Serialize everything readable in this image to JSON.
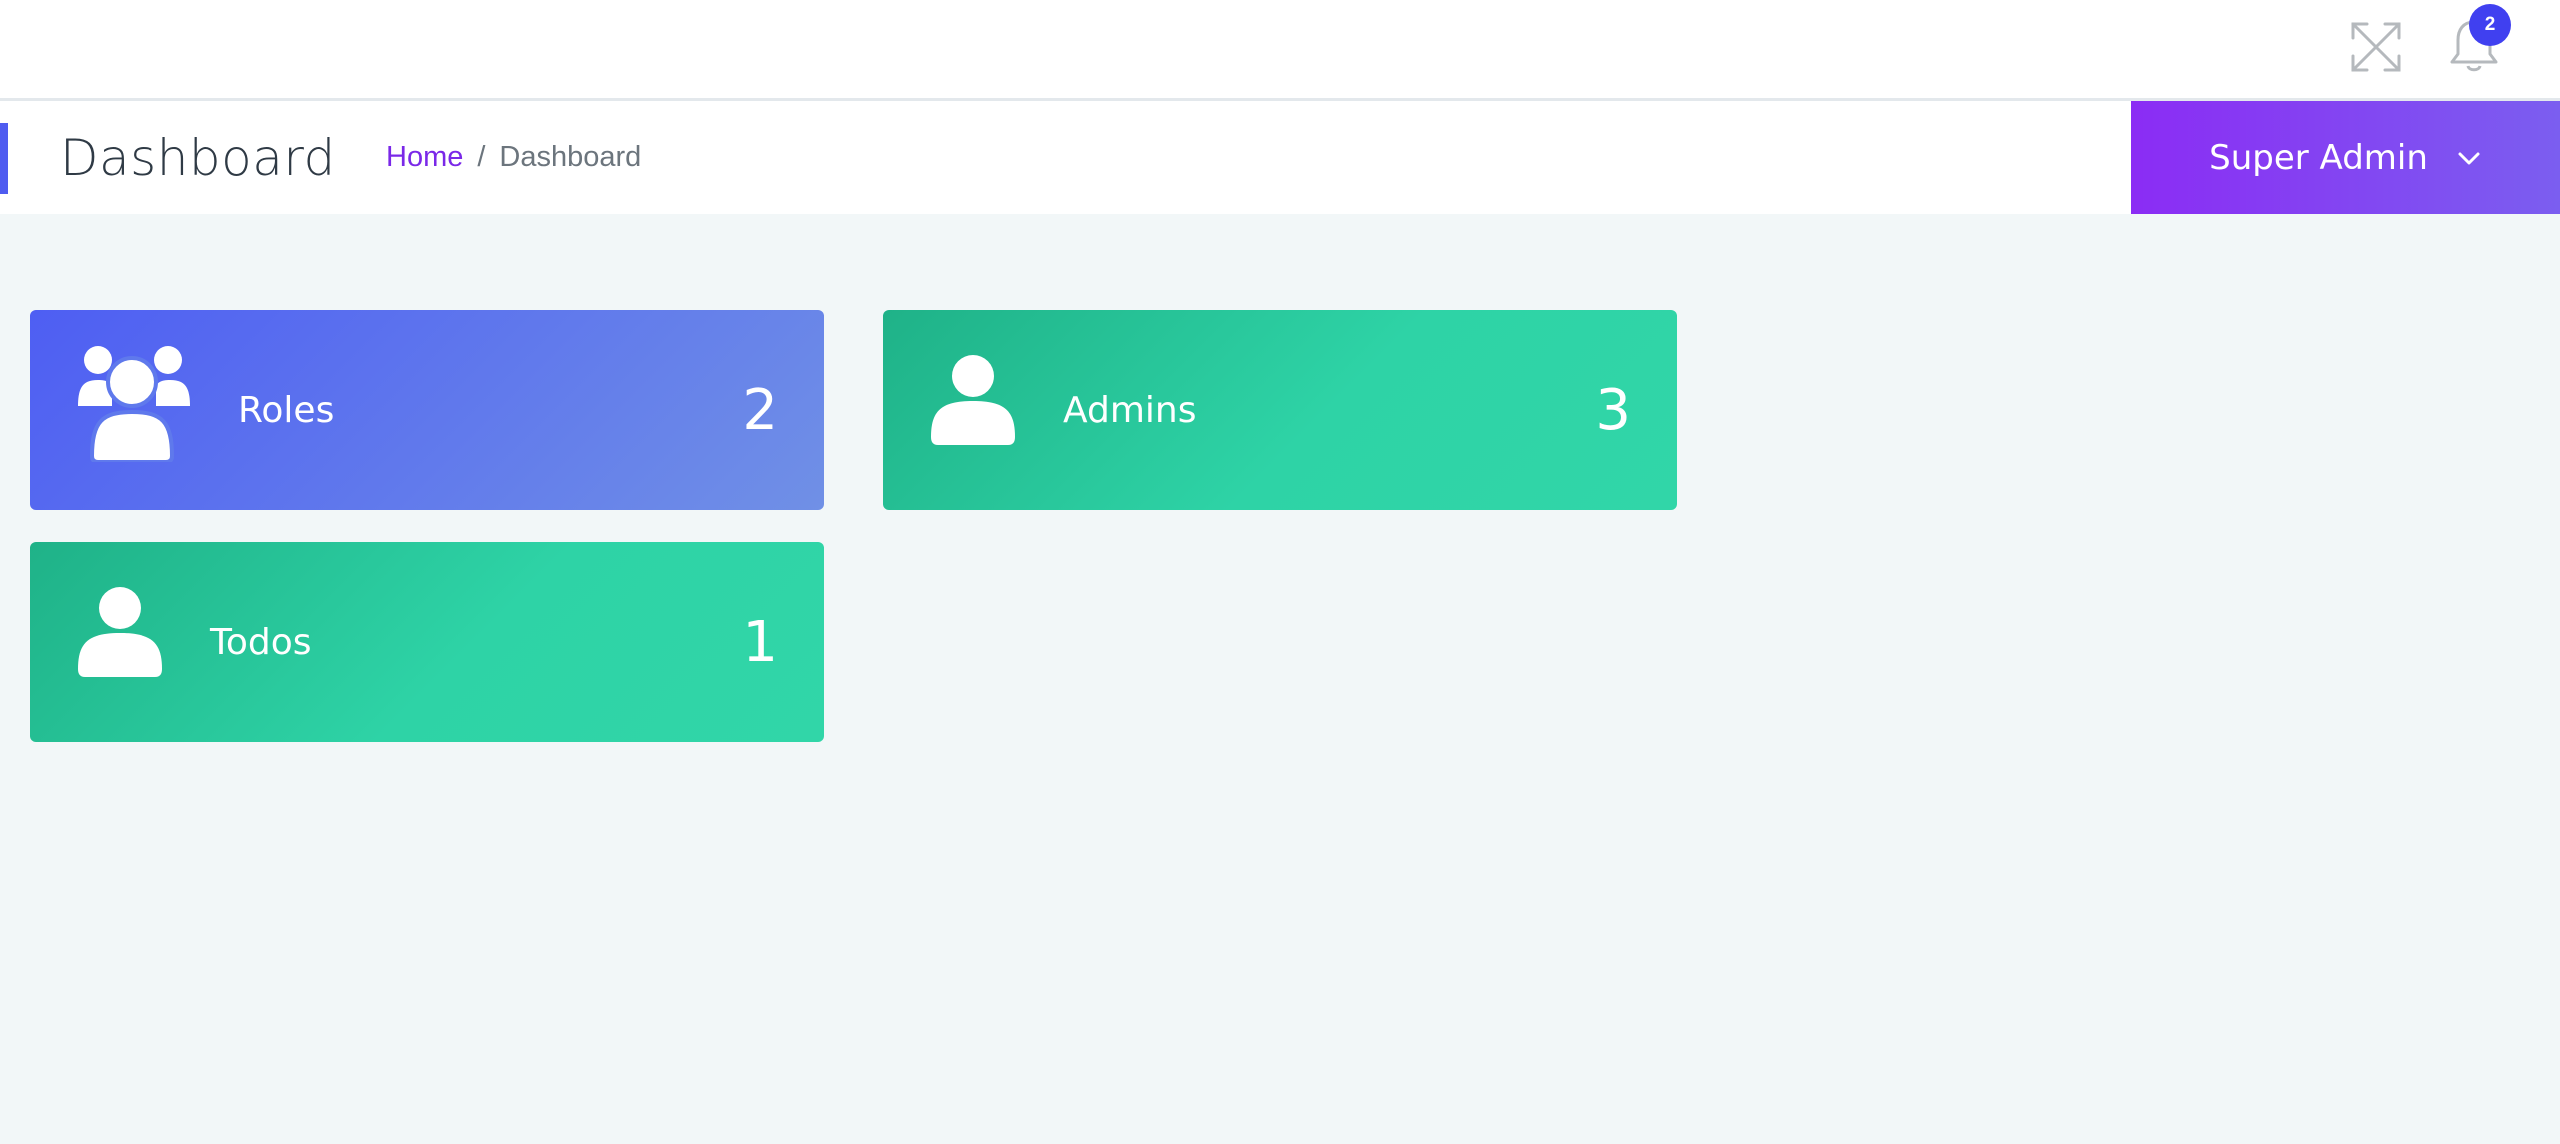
{
  "topbar": {
    "notifications": {
      "count": "2"
    }
  },
  "page": {
    "title": "Dashboard",
    "breadcrumb": [
      {
        "label": "Home"
      },
      {
        "separator": "/"
      },
      {
        "label": "Dashboard"
      }
    ]
  },
  "user_menu": {
    "label": "Super Admin"
  },
  "cards": [
    {
      "label": "Roles",
      "count": "2",
      "icon": "users-group-icon",
      "color": "#4e5ef3"
    },
    {
      "label": "Admins",
      "count": "3",
      "icon": "user-icon",
      "color": "#2ed3a6"
    },
    {
      "label": "Todos",
      "count": "1",
      "icon": "user-icon",
      "color": "#2ed3a6"
    }
  ],
  "colors": {
    "accent_purple": "#8b2cf4",
    "badge_blue": "#4040f0",
    "card_green": "#2ed3a6",
    "card_blue": "#4e5ef3"
  }
}
